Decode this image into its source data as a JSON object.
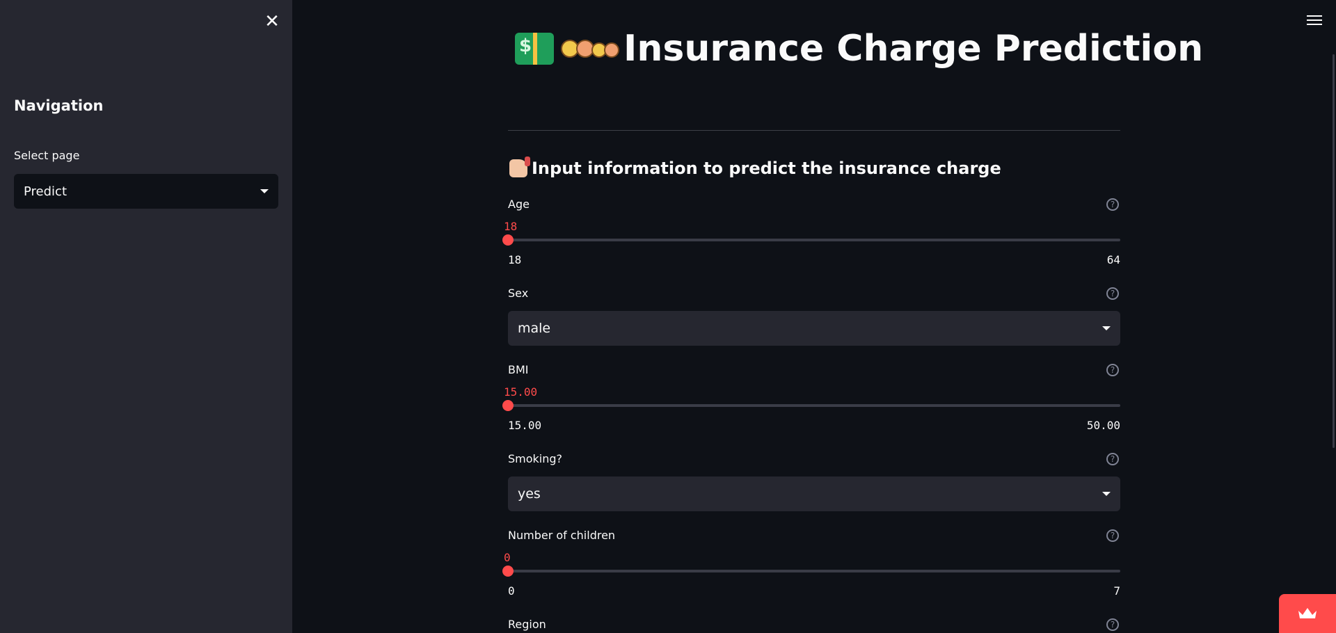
{
  "sidebar": {
    "close_glyph": "✕",
    "nav_title": "Navigation",
    "select_label": "Select page",
    "select_value": "Predict"
  },
  "header": {
    "title": "Insurance Charge Prediction",
    "icons": [
      "money-bill-icon",
      "family-icon"
    ]
  },
  "form": {
    "subheader": "Input information to predict the insurance charge",
    "age": {
      "label": "Age",
      "value": "18",
      "min": "18",
      "max": "64",
      "fraction": 0
    },
    "sex": {
      "label": "Sex",
      "value": "male"
    },
    "bmi": {
      "label": "BMI",
      "value": "15.00",
      "min": "15.00",
      "max": "50.00",
      "fraction": 0
    },
    "smoking": {
      "label": "Smoking?",
      "value": "yes"
    },
    "children": {
      "label": "Number of children",
      "value": "0",
      "min": "0",
      "max": "7",
      "fraction": 0
    },
    "region": {
      "label": "Region"
    },
    "help_glyph": "?"
  },
  "colors": {
    "accent": "#ff4b4b",
    "background": "#0e1117",
    "sidebar": "#262730"
  }
}
